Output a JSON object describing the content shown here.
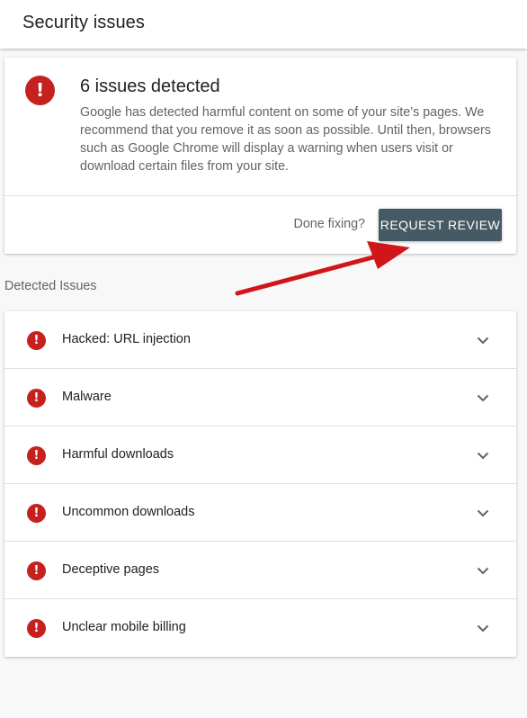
{
  "header": {
    "title": "Security issues"
  },
  "alert": {
    "icon": "error-icon",
    "icon_glyph": "!",
    "title": "6 issues detected",
    "description": "Google has detected harmful content on some of your site’s pages. We recommend that you remove it as soon as possible. Until then, browsers such as Google Chrome will display a warning when users visit or download certain files from your site.",
    "done_text": "Done fixing?",
    "review_button": "REQUEST REVIEW"
  },
  "section": {
    "label": "Detected Issues"
  },
  "issues": [
    {
      "label": "Hacked: URL injection",
      "icon_glyph": "!"
    },
    {
      "label": "Malware",
      "icon_glyph": "!"
    },
    {
      "label": "Harmful downloads",
      "icon_glyph": "!"
    },
    {
      "label": "Uncommon downloads",
      "icon_glyph": "!"
    },
    {
      "label": "Deceptive pages",
      "icon_glyph": "!"
    },
    {
      "label": "Unclear mobile billing",
      "icon_glyph": "!"
    }
  ],
  "colors": {
    "error": "#c5221f",
    "button": "#455a64",
    "annotation_arrow": "#d0161a"
  }
}
